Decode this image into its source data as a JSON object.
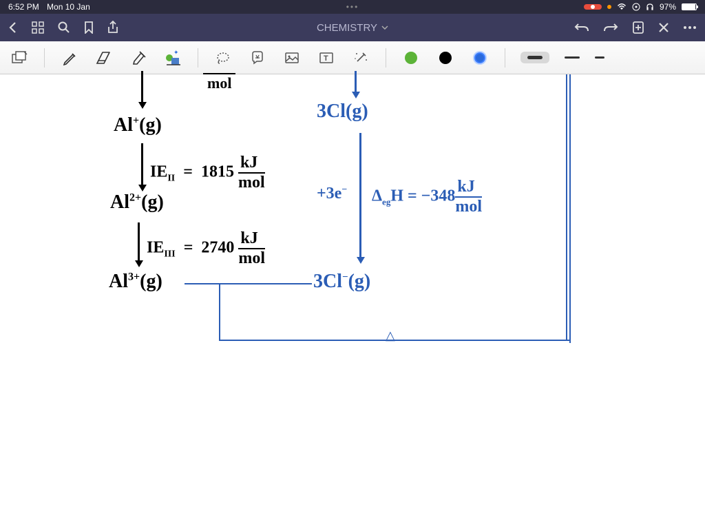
{
  "status": {
    "time": "6:52 PM",
    "date": "Mon 10 Jan",
    "battery": "97%"
  },
  "nav": {
    "title": "CHEMISTRY"
  },
  "toolbar": {
    "colors": {
      "green": "#5cb338",
      "black": "#000000",
      "blue": "#2b6adb"
    }
  },
  "notes": {
    "mol_top": "mol",
    "al_plus": "Al⁺(g)",
    "ie2": "IE",
    "ie2_sub": "II",
    "ie2_eq": "= 1815 kJ",
    "ie2_mol": "mol",
    "al_2plus": "Al²⁺(g)",
    "ie3": "IE",
    "ie3_sub": "III",
    "ie3_eq": "= 2740 kJ",
    "ie3_mol": "mol",
    "al_3plus": "Al³⁺(g)",
    "three_cl": "3Cl(g)",
    "plus_3e": "+3e⁻",
    "deg_h": "Δ",
    "deg_h_sub": "eg",
    "deg_h_rest": "H = -348kJ",
    "deg_h_mol": "mol",
    "three_cl_minus": "3Cl⁻(g)",
    "delta_sym": "△"
  }
}
